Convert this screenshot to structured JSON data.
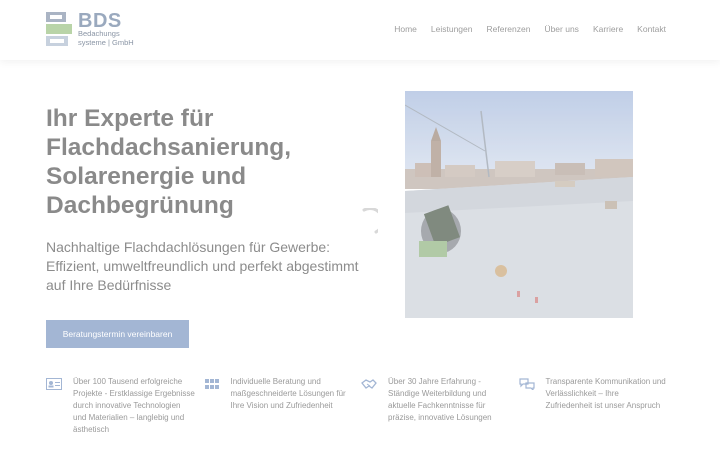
{
  "logo": {
    "name": "BDS",
    "subtitle": "Bedachungs systeme | GmbH"
  },
  "nav": {
    "items": [
      "Home",
      "Leistungen",
      "Referenzen",
      "Über uns",
      "Karriere",
      "Kontakt"
    ]
  },
  "hero": {
    "title": "Ihr Experte für Flachdachsanierung, Solarenergie und Dachbegrünung",
    "subtitle": "Nachhaltige Flachdachlösungen für Gewerbe: Effizient, umweltfreundlich und perfekt abgestimmt auf Ihre Bedürfnisse",
    "cta_label": "Beratungstermin vereinbaren"
  },
  "features": [
    {
      "icon": "id-card-icon",
      "text": "Über 100 Tausend erfolgreiche Projekte - Erstklassige Ergebnisse durch innovative Technologien und Materialien – langlebig und ästhetisch"
    },
    {
      "icon": "grid-icon",
      "text": "Individuelle Beratung und maßgeschneiderte Lösungen für Ihre Vision und Zufriedenheit"
    },
    {
      "icon": "handshake-icon",
      "text": "Über 30 Jahre Erfahrung - Ständige Weiterbildung und aktuelle Fachkenntnisse für präzise, innovative Lösungen"
    },
    {
      "icon": "chat-bubbles-icon",
      "text": "Transparente Kommunikation und Verlässlichkeit – Ihre Zufriedenheit ist unser Anspruch"
    }
  ],
  "colors": {
    "accent": "#a3b6d4",
    "logo_blue": "#9aa9be",
    "logo_green": "#b9d4a8",
    "text": "#8c8c8c"
  }
}
